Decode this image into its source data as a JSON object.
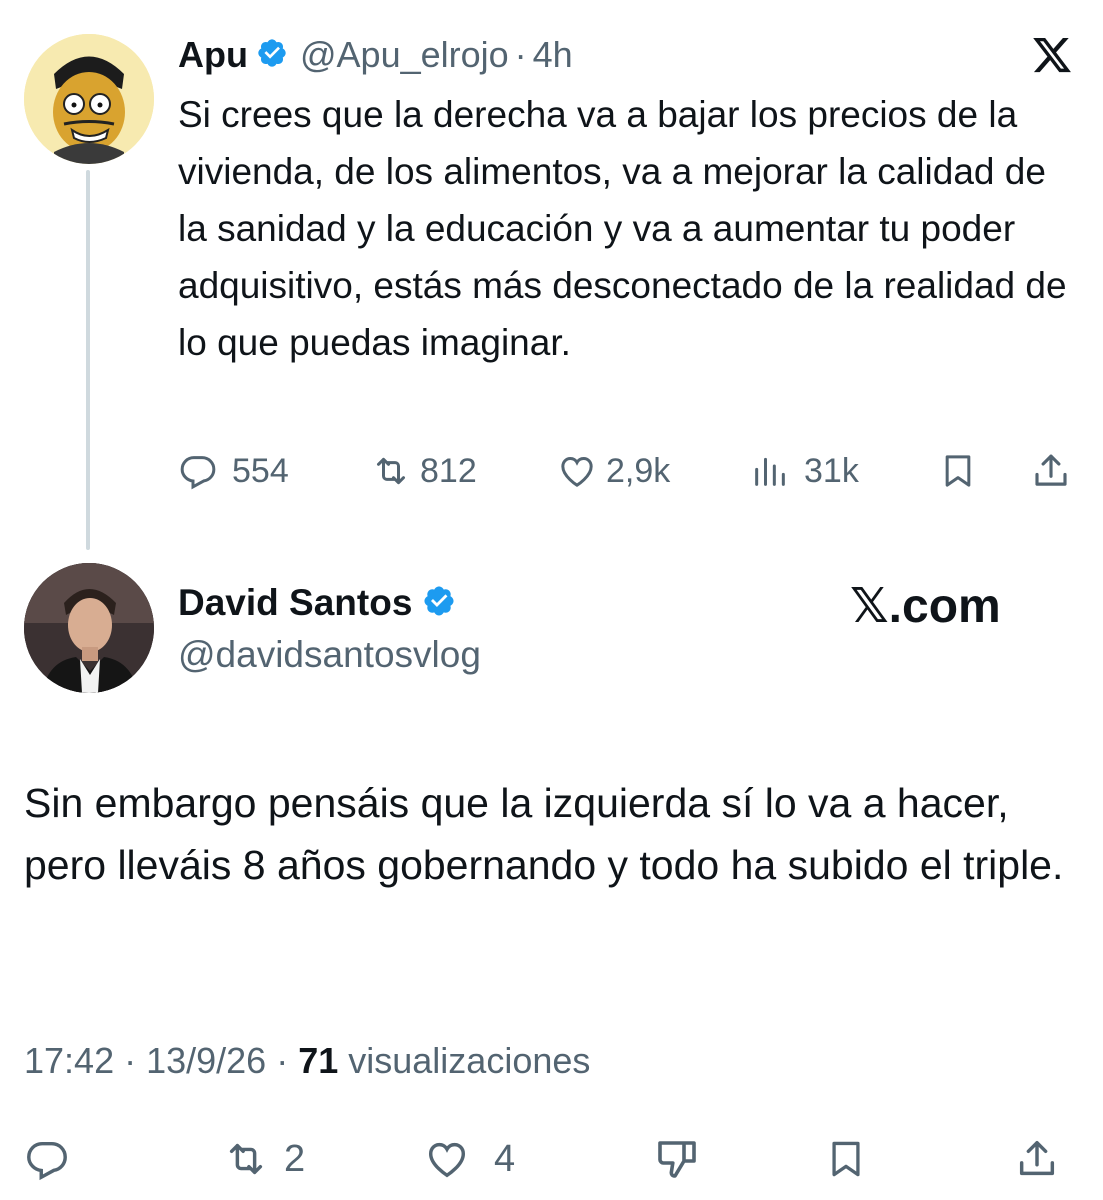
{
  "original_tweet": {
    "display_name": "Apu",
    "handle": "@Apu_elrojo",
    "separator": "·",
    "time_ago": "4h",
    "text": "Si crees que la derecha va a bajar los precios de la vivienda, de los alimentos, va a mejorar la calidad de la sanidad y la educación y va a aumentar tu poder adquisitivo, estás más desconectado de la realidad de lo que puedas imaginar.",
    "stats": {
      "replies": "554",
      "retweets": "812",
      "likes": "2,9k",
      "views": "31k"
    },
    "icons": {
      "verified": "verified-badge-icon",
      "x_logo": "x-logo-icon",
      "reply": "reply-icon",
      "retweet": "retweet-icon",
      "like": "heart-icon",
      "views": "views-icon",
      "bookmark": "bookmark-icon",
      "share": "share-icon"
    }
  },
  "reply_tweet": {
    "display_name": "David Santos",
    "handle": "@davidsantosvlog",
    "watermark": "𝕏.com",
    "text": "Sin embargo pensáis que la izquierda sí lo va a hacer, pero lleváis 8 años gobernando y todo ha subido el triple.",
    "timestamp": "17:42 · 13/9/26 ·",
    "views_count": "71",
    "views_label": "visualizaciones",
    "stats": {
      "retweets": "2",
      "likes": "4"
    },
    "icons": {
      "verified": "verified-badge-icon",
      "reply": "reply-icon",
      "retweet": "retweet-icon",
      "like": "heart-icon",
      "dislike": "thumbs-down-icon",
      "bookmark": "bookmark-icon",
      "share": "share-icon"
    }
  },
  "colors": {
    "text": "#0f1419",
    "muted": "#536471",
    "verified": "#1d9bf0",
    "thread_line": "#cfd9de"
  }
}
